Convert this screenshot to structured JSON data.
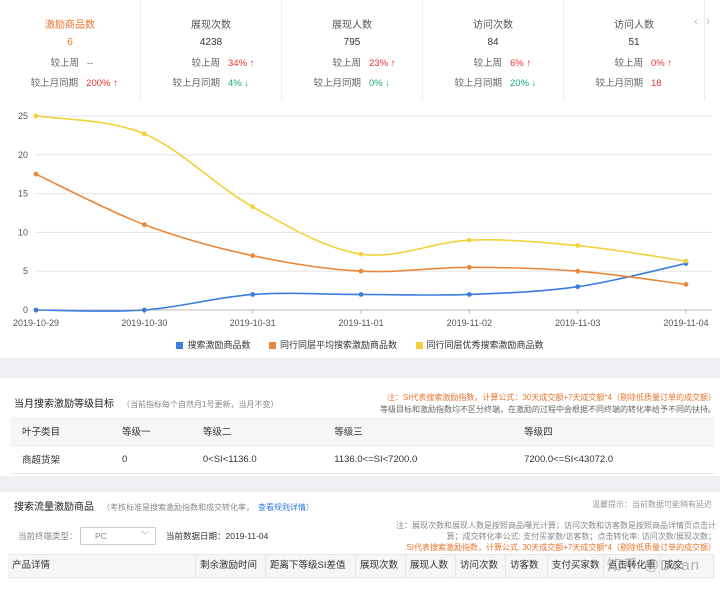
{
  "metrics": [
    {
      "title": "激励商品数",
      "value": "6",
      "rows": [
        {
          "label": "较上周",
          "value": "--",
          "trend": "neutral"
        },
        {
          "label": "较上月同期",
          "value": "200% ↑",
          "trend": "up"
        }
      ]
    },
    {
      "title": "展现次数",
      "value": "4238",
      "rows": [
        {
          "label": "较上周",
          "value": "34% ↑",
          "trend": "up"
        },
        {
          "label": "较上月同期",
          "value": "4% ↓",
          "trend": "down"
        }
      ]
    },
    {
      "title": "展现人数",
      "value": "795",
      "rows": [
        {
          "label": "较上周",
          "value": "23% ↑",
          "trend": "up"
        },
        {
          "label": "较上月同期",
          "value": "0% ↓",
          "trend": "down"
        }
      ]
    },
    {
      "title": "访问次数",
      "value": "84",
      "rows": [
        {
          "label": "较上周",
          "value": "6% ↑",
          "trend": "up"
        },
        {
          "label": "较上月同期",
          "value": "20% ↓",
          "trend": "down"
        }
      ]
    },
    {
      "title": "访问人数",
      "value": "51",
      "rows": [
        {
          "label": "较上周",
          "value": "0% ↑",
          "trend": "up"
        },
        {
          "label": "较上月同期",
          "value": "18",
          "trend": "up"
        }
      ]
    }
  ],
  "nav": {
    "prev": "‹",
    "next": "›"
  },
  "chart_data": {
    "type": "line",
    "x": [
      "2019-10-29",
      "2019-10-30",
      "2019-10-31",
      "2019-11-01",
      "2019-11-02",
      "2019-11-03",
      "2019-11-04"
    ],
    "ylim": [
      0,
      25
    ],
    "yticks": [
      0,
      5,
      10,
      15,
      20,
      25
    ],
    "grid": true,
    "legend_position": "bottom",
    "series": [
      {
        "name": "搜索激励商品数",
        "color": "#3b7ddd",
        "values": [
          0,
          0,
          2,
          2,
          2,
          3,
          6
        ]
      },
      {
        "name": "同行同层平均搜索激励商品数",
        "color": "#e8873c",
        "values": [
          17.5,
          11,
          7,
          5,
          5.5,
          5,
          3.3
        ]
      },
      {
        "name": "同行同层优秀搜索激励商品数",
        "color": "#f2d23a",
        "values": [
          25,
          22.7,
          13.3,
          7.2,
          9,
          8.3,
          6.3
        ]
      }
    ]
  },
  "targets": {
    "title": "当月搜索激励等级目标",
    "subtitle": "（当前指标每个自然月1号更新，当月不变）",
    "note1": "注：SI代表搜索激励指数，计算公式：30天成交额+7天成交额*4（剔除低质量订单的成交额）",
    "note2": "等级目标和激励指数均不区分终端，在激励的过程中会根据不同终端的转化率给予不同的扶持。",
    "headers": [
      "叶子类目",
      "等级一",
      "等级二",
      "等级三",
      "等级四"
    ],
    "row": [
      "商超货架",
      "0",
      "0<SI<1136.0",
      "1136.0<=SI<7200.0",
      "7200.0<=SI<43072.0"
    ]
  },
  "products": {
    "title": "搜索流量激励商品",
    "subtitle": "（考核标准是搜索激励指数和成交转化率，",
    "link": "查看规则详情",
    "link_close": "）",
    "tip": "温馨提示：当前数据可能稍有延迟",
    "filter_label": "当前终端类型：",
    "filter_value": "PC",
    "date_label": "当前数据日期：2019-11-04",
    "note_lines": [
      "注：展现次数和展现人数是按照商品曝光计算；访问次数和访客数是按照商品详情页点击计",
      "算；成交转化率公式: 支付买家数/访客数；点击转化率: 访问次数/展现次数；",
      "SI代表搜索激励指数，计算公式: 30天成交额+7天成交额*4（剔除低质量订单的成交额）"
    ],
    "columns": [
      "产品详情",
      "剩余激励时间",
      "距离下等级SI差值",
      "展现次数",
      "展现人数",
      "访问次数",
      "访客数",
      "支付买家数",
      "点击转化率",
      "成交"
    ],
    "watermark": "知乎 @Dean"
  }
}
